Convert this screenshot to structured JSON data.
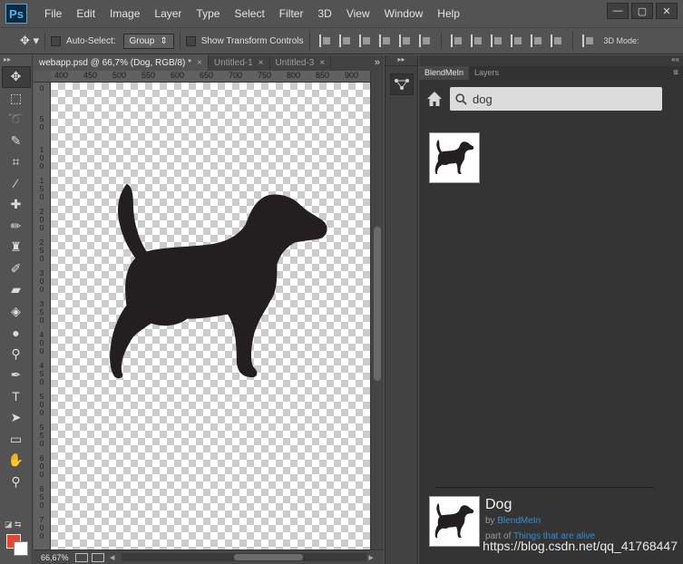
{
  "app": {
    "logo": "Ps",
    "menu": [
      "File",
      "Edit",
      "Image",
      "Layer",
      "Type",
      "Select",
      "Filter",
      "3D",
      "View",
      "Window",
      "Help"
    ],
    "window_controls": [
      "—",
      "▢",
      "✕"
    ]
  },
  "options_bar": {
    "auto_select_label": "Auto-Select:",
    "auto_select_value": "Group",
    "show_transform_label": "Show Transform Controls",
    "mode_3d_label": "3D Mode:"
  },
  "tabs": [
    {
      "label": "webapp.psd @ 66,7% (Dog, RGB/8) *",
      "active": true
    },
    {
      "label": "Untitled-1",
      "active": false
    },
    {
      "label": "Untitled-3",
      "active": false
    }
  ],
  "tabs_overflow": "»",
  "ruler": {
    "top_labels": [
      "400",
      "450",
      "500",
      "550",
      "600",
      "650",
      "700",
      "750",
      "800",
      "850",
      "900"
    ],
    "left_labels": [
      "0",
      "50",
      "100",
      "150",
      "200",
      "250",
      "300",
      "350",
      "400",
      "450",
      "500",
      "550",
      "600",
      "650",
      "700"
    ]
  },
  "status": {
    "zoom": "66,67%"
  },
  "panel": {
    "collapse_label": "««",
    "tabs": [
      {
        "label": "BlendMeIn",
        "active": true
      },
      {
        "label": "Layers",
        "active": false
      }
    ],
    "menu_icon": "≡",
    "search": {
      "value": "dog"
    },
    "detail": {
      "title": "Dog",
      "by_prefix": "by ",
      "author": "BlendMeIn",
      "part_prefix": "part of ",
      "collection": "Things that are alive"
    }
  },
  "watermark": "https://blog.csdn.net/qq_41768447",
  "colors": {
    "foreground": "#e8452c",
    "background": "#ffffff",
    "link": "#2f8fd8"
  }
}
